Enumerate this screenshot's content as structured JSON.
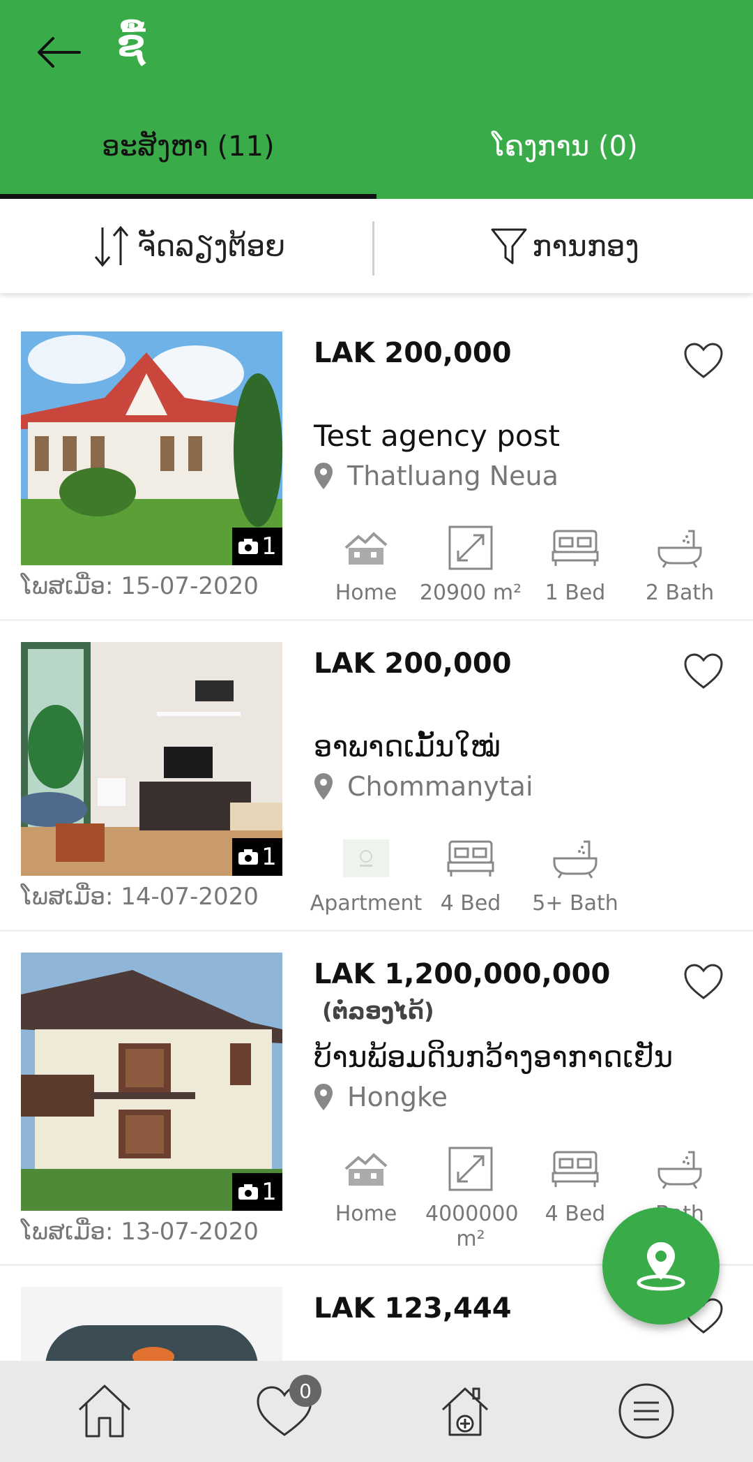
{
  "header": {
    "title": "ຊື້",
    "tabs": [
      {
        "label": "ອະສັງຫາ (11)",
        "active": true
      },
      {
        "label": "ໂຄງການ (0)",
        "active": false
      }
    ]
  },
  "toolbar": {
    "sort_label": "ຈັດລຽງຕ້ອຍ",
    "filter_label": "ການກອງ"
  },
  "listings": [
    {
      "price": "LAK 200,000",
      "negotiable": "",
      "title": "Test agency post",
      "location": "Thatluang Neua",
      "posted": "ໂພສເມື່ອ: 15-07-2020",
      "photo_count": "1",
      "features": [
        {
          "icon": "house-icon",
          "label": "Home"
        },
        {
          "icon": "area-icon",
          "label": "20900 m²"
        },
        {
          "icon": "bed-icon",
          "label": "1 Bed"
        },
        {
          "icon": "bath-icon",
          "label": "2 Bath"
        }
      ]
    },
    {
      "price": "LAK 200,000",
      "negotiable": "",
      "title": "ອາພາດເມັ້ນໃໝ່",
      "location": "Chommanytai",
      "posted": "ໂພສເມື່ອ: 14-07-2020",
      "photo_count": "1",
      "features": [
        {
          "icon": "apartment-icon",
          "label": "Apartment"
        },
        {
          "icon": "bed-icon",
          "label": "4 Bed"
        },
        {
          "icon": "bath-icon",
          "label": "5+ Bath"
        }
      ]
    },
    {
      "price": "LAK 1,200,000,000",
      "negotiable": "(ຕໍ່ລອງໄດ້)",
      "title": "ບ້ານພ້ອມດິນກວ້າງອາກາດເຢັນ",
      "location": "Hongke",
      "posted": "ໂພສເມື່ອ: 13-07-2020",
      "photo_count": "1",
      "features": [
        {
          "icon": "house-icon",
          "label": "Home"
        },
        {
          "icon": "area-icon",
          "label": "4000000 m²"
        },
        {
          "icon": "bed-icon",
          "label": "4 Bed"
        },
        {
          "icon": "bath-icon",
          "label": "Bath"
        }
      ]
    },
    {
      "price": "LAK 123,444"
    }
  ],
  "bottom_nav": {
    "items": [
      "home-icon",
      "favorites-icon",
      "add-property-icon",
      "menu-icon"
    ],
    "favorites_count": "0"
  },
  "colors": {
    "brand_green": "#3aab49",
    "muted_text": "#777777"
  }
}
